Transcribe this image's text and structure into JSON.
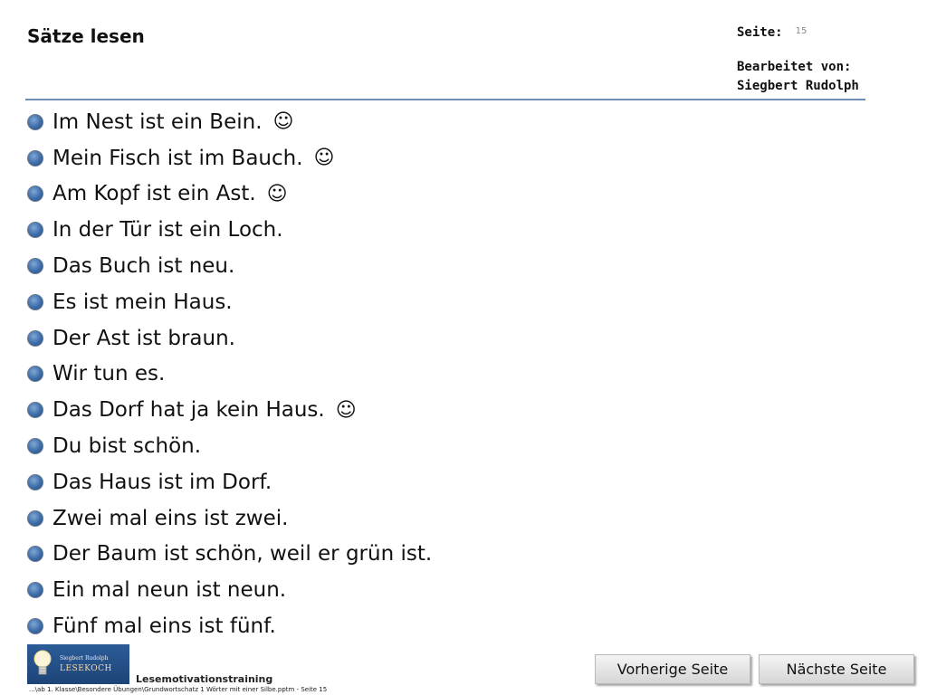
{
  "header": {
    "title": "Sätze lesen",
    "page_label": "Seite:",
    "page_number": "15",
    "editor_label": "Bearbeitet von:",
    "editor_name": "Siegbert Rudolph"
  },
  "sentences": [
    {
      "text": "Im Nest ist ein Bein.",
      "smiley": "☺"
    },
    {
      "text": "Mein Fisch ist im Bauch.",
      "smiley": "☺"
    },
    {
      "text": "Am Kopf ist ein Ast.",
      "smiley": "☺"
    },
    {
      "text": "In der Tür ist ein Loch.",
      "smiley": ""
    },
    {
      "text": "Das Buch ist neu.",
      "smiley": ""
    },
    {
      "text": "Es ist mein Haus.",
      "smiley": ""
    },
    {
      "text": "Der Ast ist braun.",
      "smiley": ""
    },
    {
      "text": "Wir tun es.",
      "smiley": ""
    },
    {
      "text": "Das Dorf hat ja kein Haus.",
      "smiley": "☺"
    },
    {
      "text": "Du bist schön.",
      "smiley": ""
    },
    {
      "text": "Das Haus ist im Dorf.",
      "smiley": ""
    },
    {
      "text": "Zwei mal eins ist zwei.",
      "smiley": ""
    },
    {
      "text": "Der Baum ist schön, weil er grün ist.",
      "smiley": ""
    },
    {
      "text": "Ein mal neun ist neun.",
      "smiley": ""
    },
    {
      "text": "Fünf mal eins ist fünf.",
      "smiley": ""
    }
  ],
  "logo": {
    "name": "Siegbert Rudolph",
    "brand": "LESEKOCH",
    "icon": "lightbulb-icon"
  },
  "footer": {
    "title": "Lesemotivationstraining",
    "path": "...\\ab 1. Klasse\\Besondere Übungen\\Grundwortschatz 1 Wörter mit einer Silbe.pptm - Seite 15"
  },
  "nav": {
    "prev_label": "Vorherige Seite",
    "next_label": "Nächste Seite"
  },
  "colors": {
    "bullet": "#3d6ca8",
    "divider": "#6f8fb8",
    "logo_bg": "#2c5c98"
  }
}
